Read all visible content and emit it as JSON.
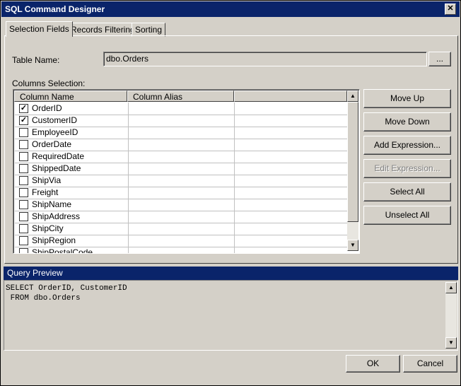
{
  "window": {
    "title": "SQL Command Designer",
    "close_glyph": "✕"
  },
  "tabs": [
    {
      "label": "Selection Fields"
    },
    {
      "label": "Records Filtering"
    },
    {
      "label": "Sorting"
    }
  ],
  "table_name": {
    "label": "Table Name:",
    "value": "dbo.Orders",
    "browse_label": "..."
  },
  "columns_selection": {
    "label": "Columns Selection:",
    "headers": [
      "Column Name",
      "Column Alias"
    ],
    "rows": [
      {
        "name": "OrderID",
        "checked": true,
        "alias": ""
      },
      {
        "name": "CustomerID",
        "checked": true,
        "alias": ""
      },
      {
        "name": "EmployeeID",
        "checked": false,
        "alias": ""
      },
      {
        "name": "OrderDate",
        "checked": false,
        "alias": ""
      },
      {
        "name": "RequiredDate",
        "checked": false,
        "alias": ""
      },
      {
        "name": "ShippedDate",
        "checked": false,
        "alias": ""
      },
      {
        "name": "ShipVia",
        "checked": false,
        "alias": ""
      },
      {
        "name": "Freight",
        "checked": false,
        "alias": ""
      },
      {
        "name": "ShipName",
        "checked": false,
        "alias": ""
      },
      {
        "name": "ShipAddress",
        "checked": false,
        "alias": ""
      },
      {
        "name": "ShipCity",
        "checked": false,
        "alias": ""
      },
      {
        "name": "ShipRegion",
        "checked": false,
        "alias": ""
      },
      {
        "name": "ShipPostalCode",
        "checked": false,
        "alias": ""
      }
    ]
  },
  "side_buttons": {
    "move_up": "Move Up",
    "move_down": "Move Down",
    "add_expression": "Add Expression...",
    "edit_expression": "Edit Expression...",
    "select_all": "Select All",
    "unselect_all": "Unselect All"
  },
  "query_preview": {
    "title": "Query Preview",
    "text": "SELECT OrderID, CustomerID\n FROM dbo.Orders"
  },
  "footer": {
    "ok": "OK",
    "cancel": "Cancel"
  },
  "icons": {
    "scroll_up": "up-arrow-icon",
    "scroll_down": "down-arrow-icon",
    "check": "check-icon"
  },
  "colors": {
    "titlebar": "#0a246a",
    "face": "#d4d0c8"
  }
}
